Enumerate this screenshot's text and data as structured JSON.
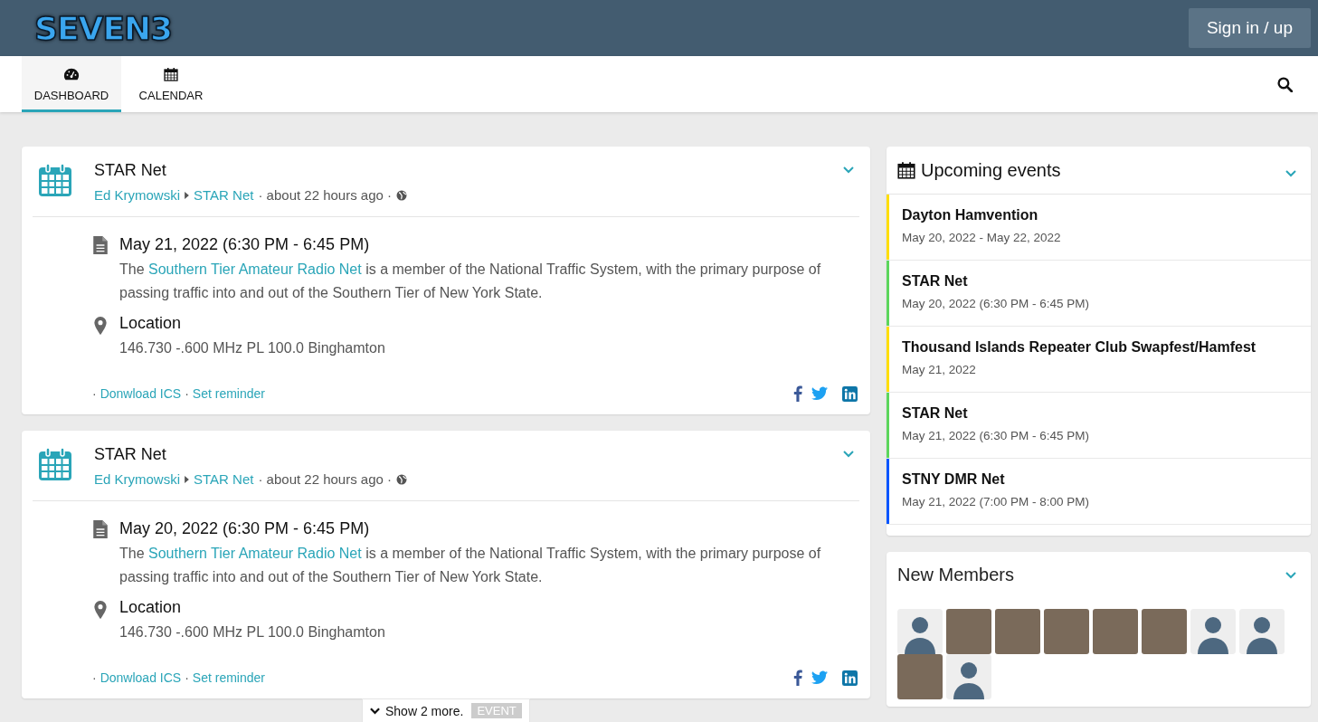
{
  "header": {
    "logo": "SEVEN3",
    "sign_in": "Sign in / up"
  },
  "tabs": [
    {
      "label": "DASHBOARD",
      "selected": true
    },
    {
      "label": "CALENDAR",
      "selected": false
    }
  ],
  "events": [
    {
      "title": "STAR Net",
      "author": "Ed Krymowski",
      "group": "STAR Net",
      "time": "· about 22 hours ago ·",
      "separator": "·",
      "date": "May 21, 2022 (6:30 PM - 6:45 PM)",
      "description_before": "The ",
      "description_link": "Southern Tier Amateur Radio Net",
      "description_after": " is a member of the National Traffic System, with the primary purpose of passing traffic into and out of the Southern Tier of New York State.",
      "location_heading": "Location",
      "location": "146.730 -.600 MHz PL 100.0 Binghamton",
      "actions": [
        "Donwload ICS",
        "Set reminder"
      ]
    },
    {
      "title": "STAR Net",
      "author": "Ed Krymowski",
      "group": "STAR Net",
      "time": "· about 22 hours ago ·",
      "separator": "·",
      "date": "May 20, 2022 (6:30 PM - 6:45 PM)",
      "description_before": "The ",
      "description_link": "Southern Tier Amateur Radio Net",
      "description_after": " is a member of the National Traffic System, with the primary purpose of passing traffic into and out of the Southern Tier of New York State.",
      "location_heading": "Location",
      "location": "146.730 -.600 MHz PL 100.0 Binghamton",
      "actions": [
        "Donwload ICS",
        "Set reminder"
      ]
    }
  ],
  "show_more": {
    "label": "Show 2 more.",
    "tag": "EVENT"
  },
  "upcoming": {
    "title_bold": "Upcoming",
    "title_rest": "events",
    "items": [
      {
        "name": "Dayton Hamvention",
        "date": "May 20, 2022 - May 22, 2022",
        "color": "#ffde00"
      },
      {
        "name": "STAR Net",
        "date": "May 20, 2022 (6:30 PM - 6:45 PM)",
        "color": "#5cd65c"
      },
      {
        "name": "Thousand Islands Repeater Club Swapfest/Hamfest",
        "date": "May 21, 2022",
        "color": "#ffde00"
      },
      {
        "name": "STAR Net",
        "date": "May 21, 2022 (6:30 PM - 6:45 PM)",
        "color": "#5cd65c"
      },
      {
        "name": "STNY DMR Net",
        "date": "May 21, 2022 (7:00 PM - 8:00 PM)",
        "color": "#0055ff"
      }
    ]
  },
  "new_members": {
    "title": "New Members",
    "members": [
      {
        "kind": "default"
      },
      {
        "kind": "photo"
      },
      {
        "kind": "photo"
      },
      {
        "kind": "photo"
      },
      {
        "kind": "photo"
      },
      {
        "kind": "photo"
      },
      {
        "kind": "default"
      },
      {
        "kind": "default"
      },
      {
        "kind": "photo"
      },
      {
        "kind": "default"
      }
    ]
  }
}
